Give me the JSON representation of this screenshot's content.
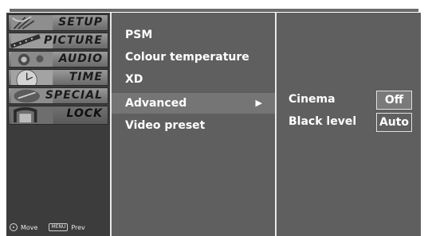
{
  "main_menu": {
    "items": [
      {
        "label": "SETUP",
        "icon": "satellite-dish-icon"
      },
      {
        "label": "PICTURE",
        "icon": "film-strip-icon"
      },
      {
        "label": "AUDIO",
        "icon": "speaker-icon"
      },
      {
        "label": "TIME",
        "icon": "clock-icon"
      },
      {
        "label": "SPECIAL",
        "icon": "special-badge-icon"
      },
      {
        "label": "LOCK",
        "icon": "lock-icon"
      }
    ],
    "footer": {
      "move_label": "Move",
      "menu_key": "MENU",
      "prev_label": "Prev"
    }
  },
  "picture_menu": {
    "items": [
      {
        "label": "PSM"
      },
      {
        "label": "Colour temperature"
      },
      {
        "label": "XD"
      },
      {
        "label": "Advanced",
        "selected": true,
        "arrow": "▶"
      },
      {
        "label": "Video preset"
      }
    ]
  },
  "advanced_panel": {
    "rows": [
      {
        "label": "Cinema",
        "value": "Off"
      },
      {
        "label": "Black level",
        "value": "Auto"
      }
    ]
  },
  "colors": {
    "osd_background": "#5f5f5f",
    "menu_column": "#3c3c3c",
    "selected_row": "#757575",
    "text": "#ffffff"
  }
}
